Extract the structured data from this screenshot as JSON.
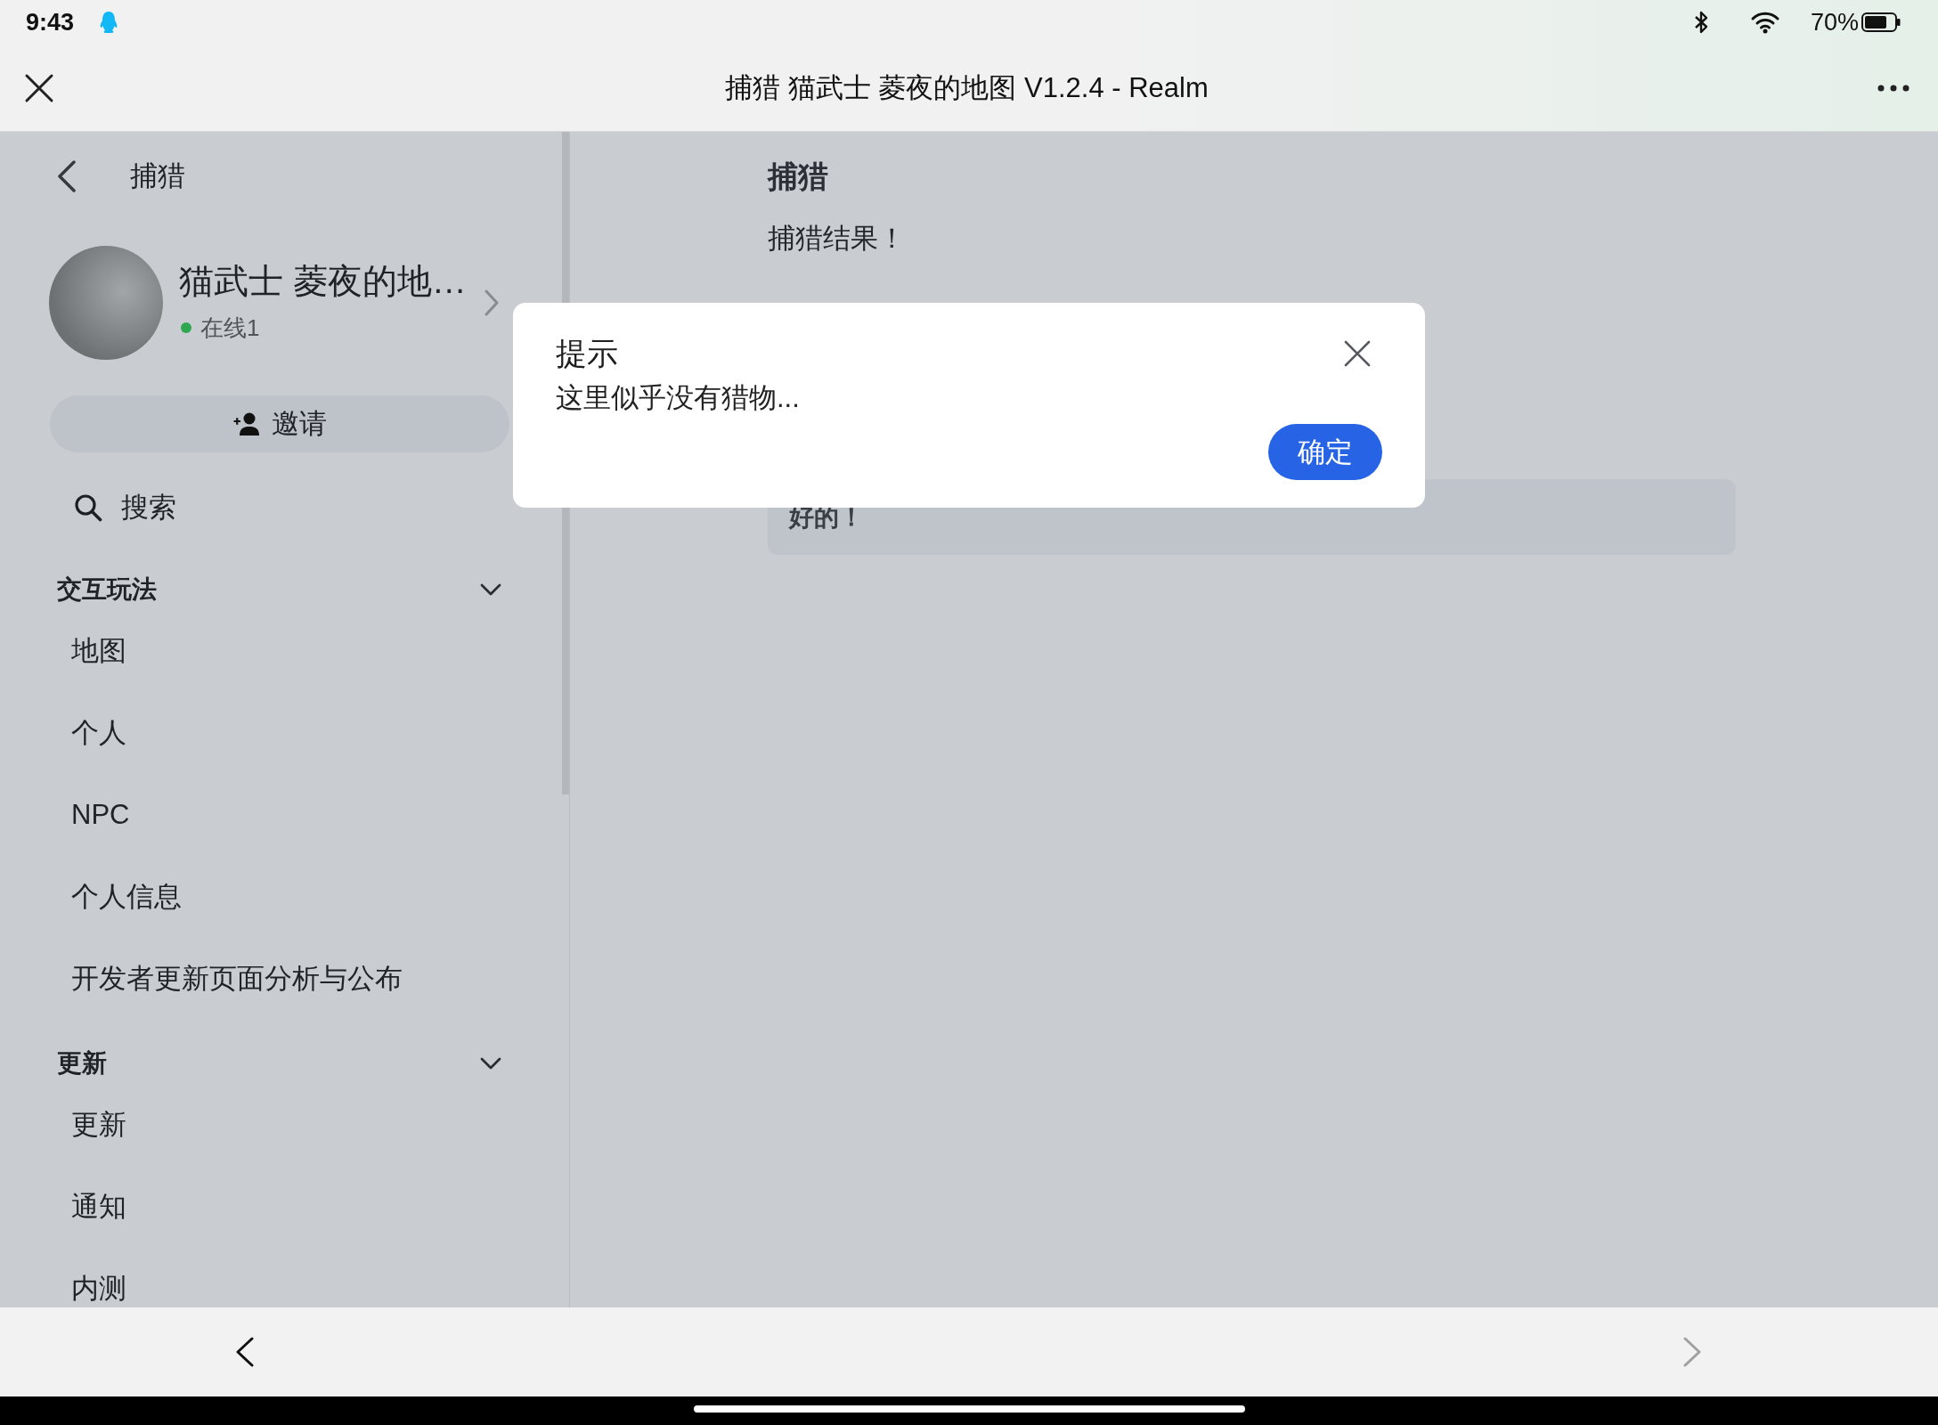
{
  "status_bar": {
    "time": "9:43",
    "battery": "70%"
  },
  "window": {
    "title": "捕猎 猫武士 菱夜的地图 V1.2.4 - Realm"
  },
  "sidebar": {
    "back_label": "捕猎",
    "realm": {
      "name": "猫武士 菱夜的地…",
      "status": "在线1"
    },
    "invite_button": "邀请",
    "search": "搜索",
    "sections": [
      {
        "title": "交互玩法",
        "expanded": true,
        "items": [
          "地图",
          "个人",
          "NPC",
          "个人信息",
          "开发者更新页面分析与公布"
        ]
      },
      {
        "title": "更新",
        "expanded": true,
        "items": [
          "更新",
          "通知",
          "内测"
        ]
      }
    ]
  },
  "content": {
    "title": "捕猎",
    "text": "捕猎结果！",
    "buttons": [
      "好的！"
    ]
  },
  "dialog": {
    "title": "提示",
    "message": "这里似乎没有猎物...",
    "confirm": "确定"
  },
  "bottom_nav": {
    "back": {
      "disabled": false
    },
    "forward": {
      "disabled": true
    }
  }
}
